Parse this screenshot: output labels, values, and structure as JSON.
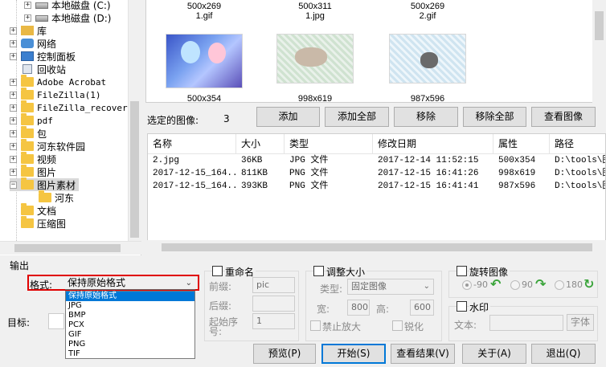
{
  "tree": {
    "items": [
      {
        "label": "本地磁盘 (C:)",
        "icon": "drive-icon"
      },
      {
        "label": "本地磁盘 (D:)",
        "icon": "drive-icon"
      },
      {
        "label": "库",
        "icon": "library-icon"
      },
      {
        "label": "网络",
        "icon": "network-icon"
      },
      {
        "label": "控制面板",
        "icon": "control-panel-icon"
      },
      {
        "label": "回收站",
        "icon": "recycle-bin-icon"
      },
      {
        "label": "Adobe Acrobat",
        "icon": "folder-icon"
      },
      {
        "label": "FileZilla(1)",
        "icon": "folder-icon"
      },
      {
        "label": "FileZilla_recovered",
        "icon": "folder-icon"
      },
      {
        "label": "pdf",
        "icon": "folder-icon"
      },
      {
        "label": "包",
        "icon": "folder-icon"
      },
      {
        "label": "河东软件园",
        "icon": "folder-icon"
      },
      {
        "label": "视频",
        "icon": "folder-icon"
      },
      {
        "label": "图片",
        "icon": "folder-icon"
      },
      {
        "label": "图片素材",
        "icon": "folder-icon"
      },
      {
        "label": "河东",
        "icon": "folder-icon"
      },
      {
        "label": "文档",
        "icon": "folder-icon"
      },
      {
        "label": "压缩图",
        "icon": "folder-icon"
      }
    ]
  },
  "thumbs": {
    "top_row": [
      {
        "size": "500x269",
        "name": "1.gif"
      },
      {
        "size": "500x311",
        "name": "1.jpg"
      },
      {
        "size": "500x269",
        "name": "2.gif"
      }
    ],
    "bottom_row": [
      {
        "size": "500x354"
      },
      {
        "size": "998x619"
      },
      {
        "size": "987x596"
      }
    ]
  },
  "selection": {
    "label": "选定的图像:",
    "count": "3",
    "add": "添加",
    "add_all": "添加全部",
    "remove": "移除",
    "remove_all": "移除全部",
    "view": "查看图像"
  },
  "filelist": {
    "headers": [
      "名称",
      "大小",
      "类型",
      "修改日期",
      "属性",
      "路径"
    ],
    "rows": [
      [
        "2.jpg",
        "36KB",
        "JPG 文件",
        "2017-12-14 11:52:15",
        "500x354",
        "D:\\tools\\图"
      ],
      [
        "2017-12-15_164...",
        "811KB",
        "PNG 文件",
        "2017-12-15 16:41:26",
        "998x619",
        "D:\\tools\\图"
      ],
      [
        "2017-12-15_164...",
        "393KB",
        "PNG 文件",
        "2017-12-15 16:41:41",
        "987x596",
        "D:\\tools\\图"
      ]
    ]
  },
  "output": {
    "title": "输出",
    "format_label": "格式:",
    "format_value": "保持原始格式",
    "format_options": [
      "保持原始格式",
      "JPG",
      "BMP",
      "PCX",
      "GIF",
      "PNG",
      "TIF"
    ],
    "target_label": "目标:"
  },
  "rename": {
    "title": "重命名",
    "prefix_label": "前缀:",
    "prefix_value": "pic",
    "suffix_label": "后缀:",
    "start_label_1": "起始序",
    "start_label_2": "号:",
    "start_value": "1"
  },
  "resize": {
    "title": "调整大小",
    "type_label": "类型:",
    "type_value": "固定图像",
    "width_label": "宽:",
    "width_value": "800",
    "height_label": "高:",
    "height_value": "600",
    "no_enlarge": "禁止放大",
    "sharpen": "锐化"
  },
  "rotate": {
    "title": "旋转图像",
    "opt1": "-90",
    "opt2": "90",
    "opt3": "180"
  },
  "watermark": {
    "title": "水印",
    "text_label": "文本:",
    "font_button": "字体"
  },
  "actions": {
    "preview": "预览(P)",
    "start": "开始(S)",
    "results": "查看结果(V)",
    "about": "关于(A)",
    "exit": "退出(Q)"
  },
  "colors": {
    "accent": "#0078d7",
    "highlight_border": "#e00000",
    "folder": "#f5c542"
  }
}
